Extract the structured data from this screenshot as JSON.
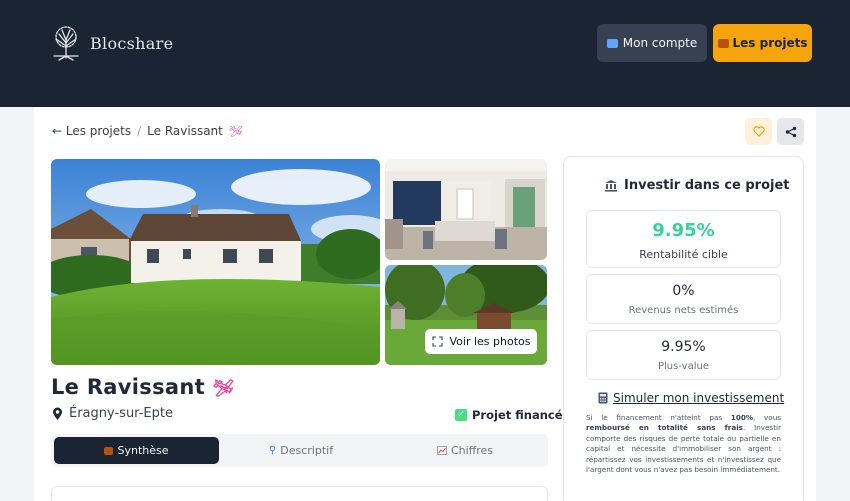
{
  "header": {
    "brand": "Blocshare",
    "account_label": "Mon compte",
    "projects_label": "Les projets",
    "icons": [
      "tree-logo-icon",
      "computer-icon",
      "house-icon"
    ]
  },
  "breadcrumb": {
    "back_label": "← Les projets",
    "separator": "/",
    "current": "Le Ravissant",
    "current_emoji": "🛩"
  },
  "gallery": {
    "photos_button_label": "Voir les photos"
  },
  "project": {
    "title": "Le Ravissant",
    "title_emoji": "🛩",
    "location": "Éragny-sur-Epte",
    "status": "Projet financé"
  },
  "tabs": [
    {
      "label": "Synthèse",
      "icon": "house-icon",
      "active": true
    },
    {
      "label": "Descriptif",
      "icon": "magnifier-icon",
      "active": false
    },
    {
      "label": "Chiffres",
      "icon": "chart-icon",
      "active": false
    }
  ],
  "invest": {
    "title": "Investir dans ce projet",
    "stats": [
      {
        "value": "9.95%",
        "label": "Rentabilité cible"
      },
      {
        "value": "0%",
        "label": "Revenus nets estimés"
      },
      {
        "value": "9.95%",
        "label": "Plus-value"
      }
    ],
    "simulate_label": "Simuler mon investissement",
    "disclaimer_1": "Si le financement n'atteint pas ",
    "disclaimer_bold_1": "100%",
    "disclaimer_2": ", vous ",
    "disclaimer_bold_2": "remboursé en totalité sans frais",
    "disclaimer_3": ". Investir comporte des risques de perte totale ou partielle en capital et nécessite d'immobiliser son argent : répartissez vos investissements et n'investissez que l'argent dont vous n'avez pas besoin immédiatement."
  },
  "colors": {
    "header_bg": "#1b2432",
    "accent": "#f5a50b",
    "rate": "#34d399"
  }
}
